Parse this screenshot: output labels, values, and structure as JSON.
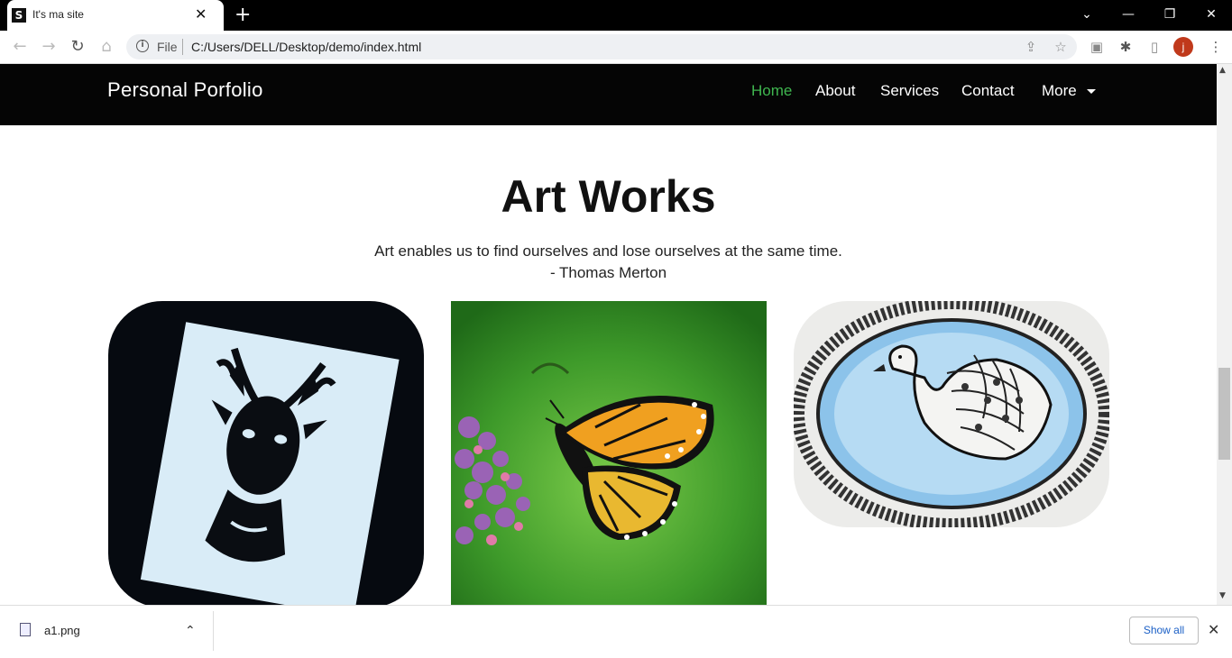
{
  "browser": {
    "tab_title": "It's ma site",
    "tab_close": "✕",
    "new_tab": "+",
    "window_controls": {
      "tab_search": "⌄",
      "minimize": "—",
      "restore": "❐",
      "close": "✕"
    },
    "nav": {
      "back": "←",
      "forward": "→",
      "reload": "↻",
      "home": "⌂"
    },
    "file_label": "File",
    "url": "C:/Users/DELL/Desktop/demo/index.html",
    "icons": [
      "info-icon",
      "share-icon",
      "star-icon",
      "pocket-icon",
      "extensions-icon",
      "sidepanel-icon",
      "profile-avatar",
      "menu-icon"
    ],
    "avatar_letter": "j",
    "menu": "⋮"
  },
  "site": {
    "brand": "Personal Porfolio",
    "nav": [
      {
        "label": "Home",
        "active": true
      },
      {
        "label": "About"
      },
      {
        "label": "Services"
      },
      {
        "label": "Contact"
      },
      {
        "label": "More"
      }
    ],
    "heading": "Art Works",
    "quote_line1": "Art enables us to find ourselves and lose ourselves at the same time.",
    "quote_line2": "- Thomas Merton",
    "artworks": [
      "deer stencil art",
      "monarch butterfly painting",
      "swan mandala drawing"
    ]
  },
  "download_bar": {
    "file_name": "a1.png",
    "show_all": "Show all",
    "close": "✕",
    "chevron": "⌃"
  },
  "colors": {
    "nav_active": "#3fb64f",
    "navbar_bg": "#050505",
    "show_all_text": "#1a5fc6"
  }
}
